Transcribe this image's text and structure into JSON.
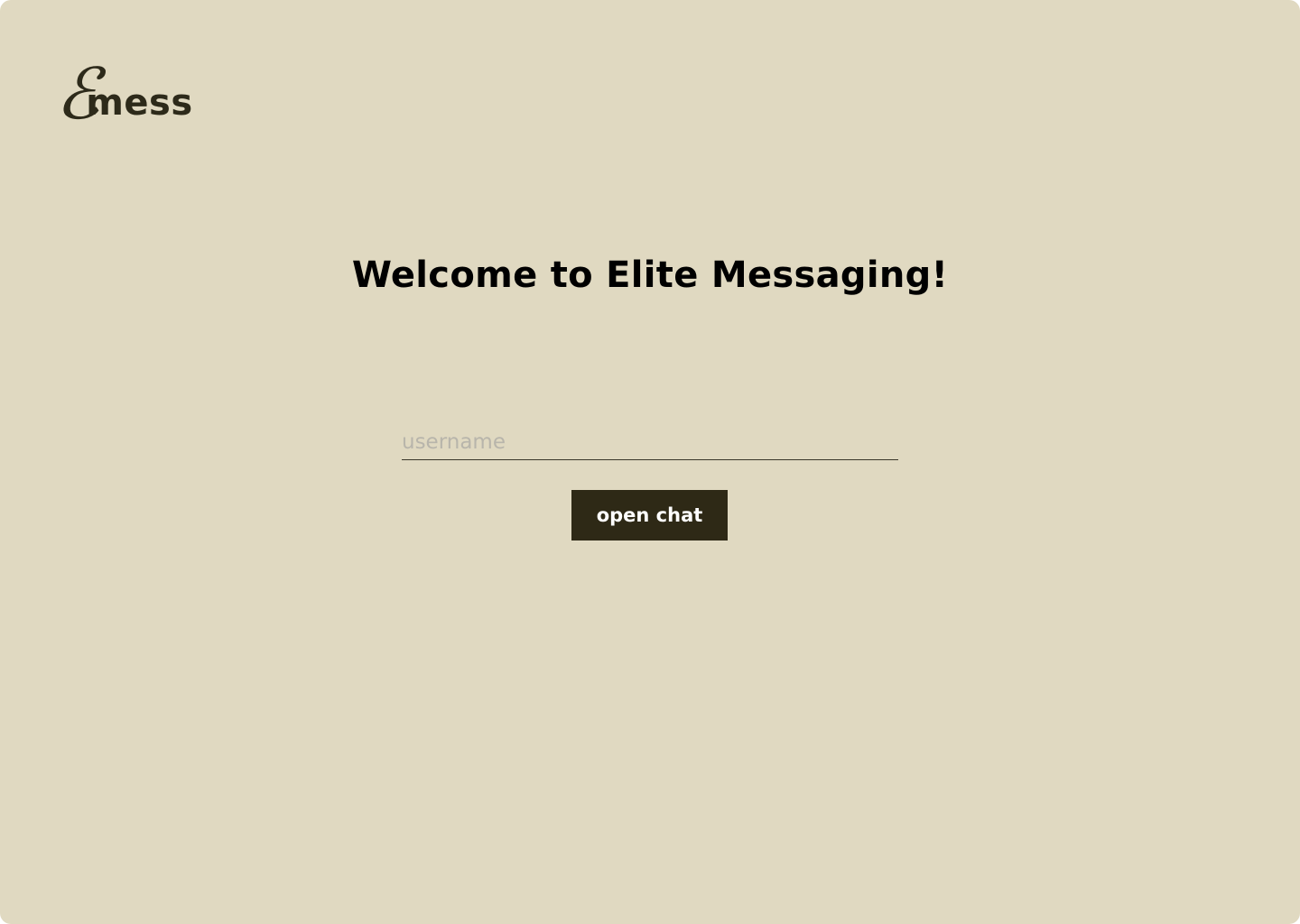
{
  "logo": {
    "mark": "ℰ",
    "word": "mess"
  },
  "welcome": {
    "title": "Welcome to Elite Messaging!"
  },
  "login": {
    "username_value": "",
    "username_placeholder": "username",
    "open_chat_label": "open chat"
  },
  "colors": {
    "background": "#e0d9c1",
    "button": "#2e2916",
    "button_text": "#ffffff",
    "logo": "#2d2a1a",
    "placeholder": "#b8b5ab"
  }
}
